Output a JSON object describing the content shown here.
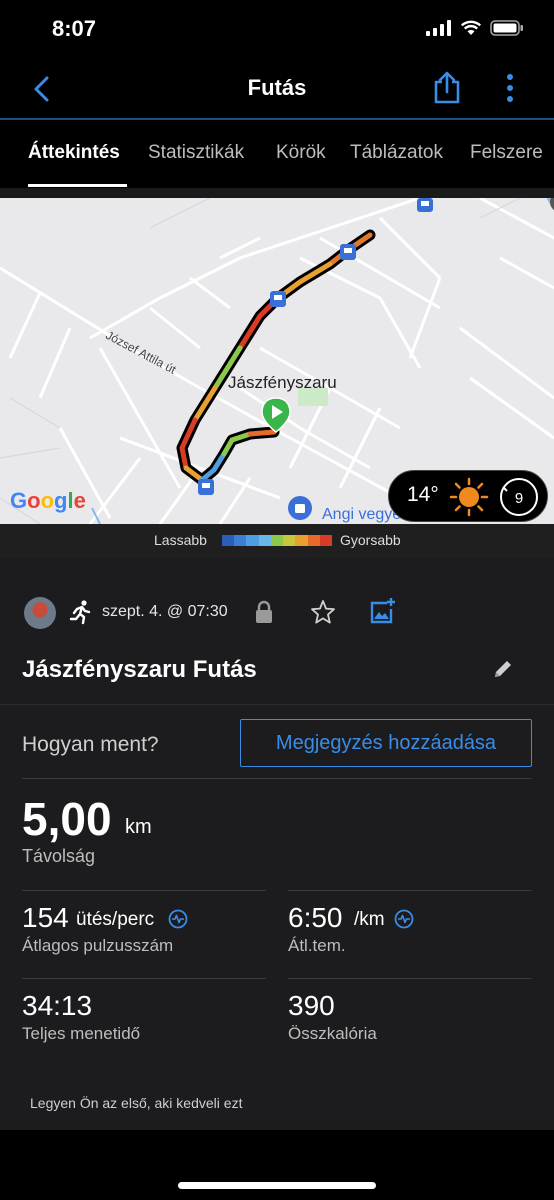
{
  "status_bar": {
    "time": "8:07"
  },
  "nav": {
    "title": "Futás"
  },
  "tabs": [
    {
      "label": "Áttekintés",
      "active": true
    },
    {
      "label": "Statisztikák",
      "active": false
    },
    {
      "label": "Körök",
      "active": false
    },
    {
      "label": "Táblázatok",
      "active": false
    },
    {
      "label": "Felszere",
      "active": false
    }
  ],
  "map": {
    "town": "Jászfényszaru",
    "street": "József Attila út",
    "poi": "Angi vegyeskere",
    "google_logo": "Google",
    "weather": {
      "temp": "14°",
      "wind": "9"
    }
  },
  "legend": {
    "slow": "Lassabb",
    "fast": "Gyorsabb",
    "colors": [
      "#2a5fb8",
      "#3d7dd6",
      "#4d9fe0",
      "#67b8e6",
      "#8cc84b",
      "#c8c63a",
      "#e8a030",
      "#e86a2a",
      "#d83c24"
    ]
  },
  "activity": {
    "date": "szept. 4. @ 07:30",
    "title": "Jászfényszaru Futás",
    "how_label": "Hogyan ment?",
    "note_button": "Megjegyzés hozzáadása",
    "distance": {
      "value": "5,00",
      "unit": "km",
      "label": "Távolság"
    },
    "heart_rate": {
      "value": "154",
      "unit": "ütés/perc",
      "label": "Átlagos pulzusszám"
    },
    "pace": {
      "value": "6:50",
      "unit": "/km",
      "label": "Átl.tem."
    },
    "time": {
      "value": "34:13",
      "label": "Teljes menetidő"
    },
    "calories": {
      "value": "390",
      "label": "Összkalória"
    },
    "like_text": "Legyen Ön az első, aki kedveli ezt"
  },
  "colors": {
    "accent": "#3a8de6",
    "background": "#1c1c1e"
  }
}
